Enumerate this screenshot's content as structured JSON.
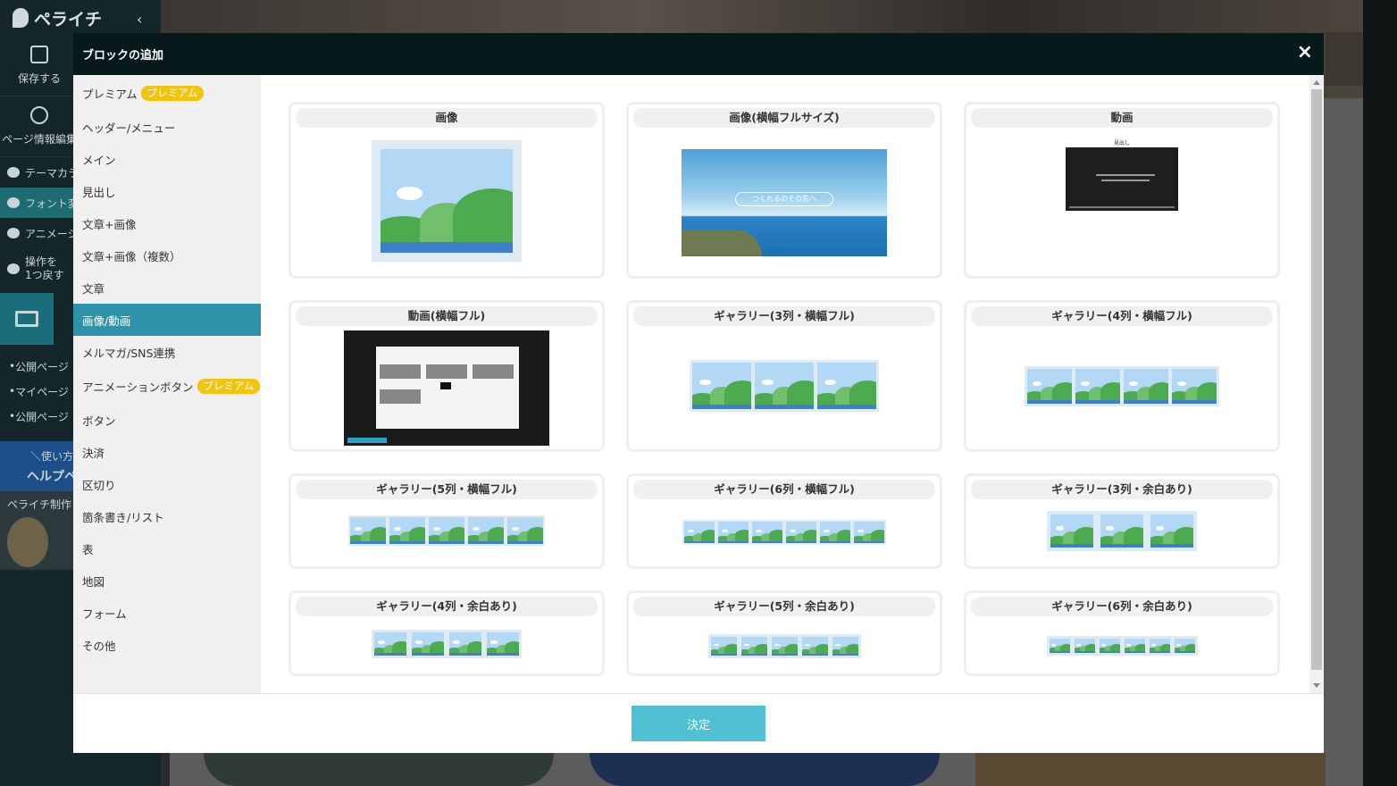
{
  "app": {
    "logo": "ペライチ",
    "sidebar": {
      "save_label": "保存する",
      "page_info_label": "ページ情報編集",
      "theme_label": "テーマカラー",
      "font_label": "フォント変更",
      "animation_label": "アニメーション",
      "undo_label_line1": "操作を",
      "undo_label_line2": "1つ戻す",
      "links": [
        "公開ページ",
        "マイページ",
        "公開ページ"
      ],
      "help_line1": "＼使い方",
      "help_line2": "ヘルプペ",
      "promo_title": "ペライチ制作"
    }
  },
  "modal": {
    "title": "ブロックの追加",
    "close_icon": "×",
    "confirm_label": "決定",
    "categories": [
      {
        "label": "プレミアム",
        "badge": "プレミアム"
      },
      {
        "label": "ヘッダー/メニュー"
      },
      {
        "label": "メイン"
      },
      {
        "label": "見出し"
      },
      {
        "label": "文章+画像"
      },
      {
        "label": "文章+画像（複数）"
      },
      {
        "label": "文章"
      },
      {
        "label": "画像/動画",
        "active": true
      },
      {
        "label": "メルマガ/SNS連携"
      },
      {
        "label": "アニメーションボタン",
        "badge": "プレミアム"
      },
      {
        "label": "ボタン"
      },
      {
        "label": "決済"
      },
      {
        "label": "区切り"
      },
      {
        "label": "箇条書き/リスト"
      },
      {
        "label": "表"
      },
      {
        "label": "地図"
      },
      {
        "label": "フォーム"
      },
      {
        "label": "その他"
      }
    ],
    "blocks": [
      {
        "title": "画像",
        "thumbnail": "image-placeholder"
      },
      {
        "title": "画像(横幅フルサイズ)",
        "thumbnail": "landscape-photo",
        "photo_caption": "つくれるのその先へ"
      },
      {
        "title": "動画",
        "thumbnail": "video-player",
        "video_heading": "見出し"
      },
      {
        "title": "動画(横幅フル)",
        "thumbnail": "editor-screenshot"
      },
      {
        "title": "ギャラリー(3列・横幅フル)",
        "thumbnail": "gallery-3"
      },
      {
        "title": "ギャラリー(4列・横幅フル)",
        "thumbnail": "gallery-4"
      },
      {
        "title": "ギャラリー(5列・横幅フル)",
        "thumbnail": "gallery-5"
      },
      {
        "title": "ギャラリー(6列・横幅フル)",
        "thumbnail": "gallery-6"
      },
      {
        "title": "ギャラリー(3列・余白あり)",
        "thumbnail": "gallery-3-spaced"
      },
      {
        "title": "ギャラリー(4列・余白あり)",
        "thumbnail": "gallery-4-spaced"
      },
      {
        "title": "ギャラリー(5列・余白あり)",
        "thumbnail": "gallery-5-spaced"
      },
      {
        "title": "ギャラリー(6列・余白あり)",
        "thumbnail": "gallery-6-spaced"
      }
    ]
  },
  "colors": {
    "modal_header": "#08191c",
    "active_category": "#2e93a8",
    "premium_badge": "#f1c40f",
    "confirm_button": "#4fc1d2"
  }
}
